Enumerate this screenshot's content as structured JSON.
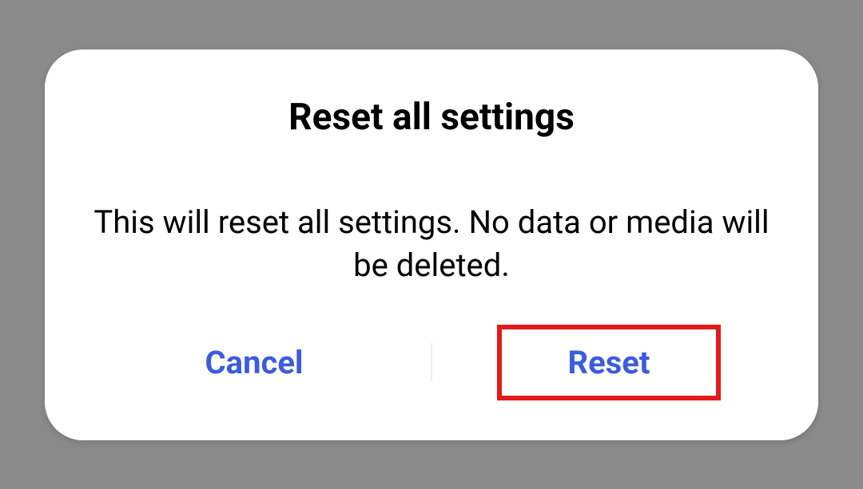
{
  "dialog": {
    "title": "Reset all settings",
    "message": "This will reset all settings. No data or media will be deleted.",
    "buttons": {
      "cancel": "Cancel",
      "reset": "Reset"
    }
  }
}
